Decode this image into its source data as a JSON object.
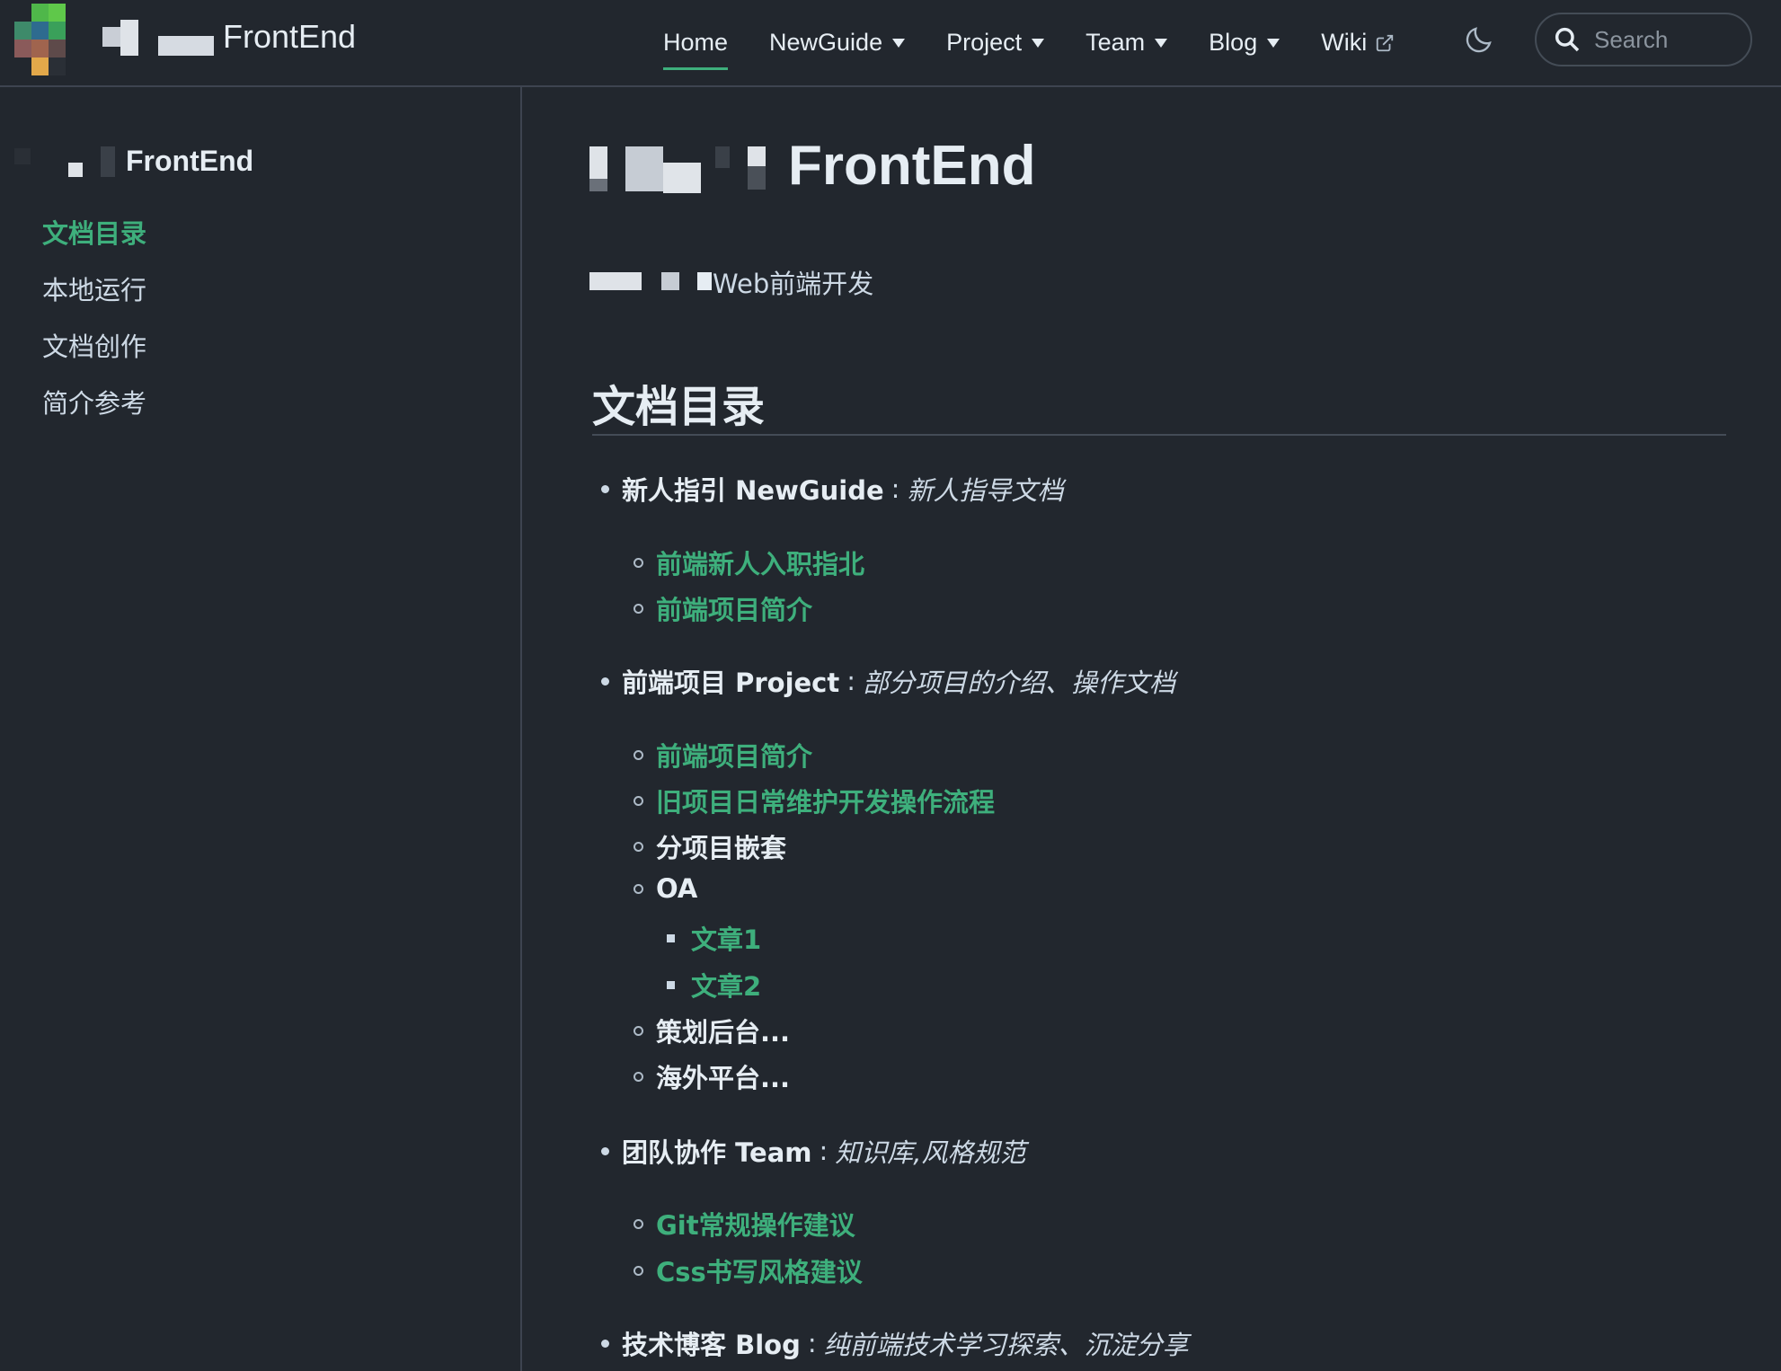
{
  "brand": {
    "name": "FrontEnd"
  },
  "nav": {
    "items": [
      {
        "label": "Home",
        "dropdown": false,
        "active": true
      },
      {
        "label": "NewGuide",
        "dropdown": true
      },
      {
        "label": "Project",
        "dropdown": true
      },
      {
        "label": "Team",
        "dropdown": true
      },
      {
        "label": "Blog",
        "dropdown": true
      },
      {
        "label": "Wiki",
        "dropdown": false,
        "external": true
      }
    ],
    "theme_toggle_icon": "moon-icon",
    "search_placeholder": "Search"
  },
  "sidebar": {
    "title": "FrontEnd",
    "items": [
      {
        "label": "文档目录",
        "active": true
      },
      {
        "label": "本地运行"
      },
      {
        "label": "文档创作"
      },
      {
        "label": "简介参考"
      }
    ]
  },
  "main": {
    "title": "FrontEnd",
    "tagline": "Web前端开发",
    "section_heading": "文档目录",
    "sections": [
      {
        "name": "新人指引 NewGuide",
        "desc": "新人指导文档",
        "children": [
          {
            "label": "前端新人入职指北",
            "link": true
          },
          {
            "label": "前端项目简介",
            "link": true
          }
        ]
      },
      {
        "name": "前端项目 Project",
        "desc": "部分项目的介绍、操作文档",
        "children": [
          {
            "label": "前端项目简介",
            "link": true
          },
          {
            "label": "旧项目日常维护开发操作流程",
            "link": true
          },
          {
            "label": "分项目嵌套",
            "link": false
          },
          {
            "label": "OA",
            "link": false,
            "children": [
              {
                "label": "文章1"
              },
              {
                "label": "文章2"
              }
            ]
          },
          {
            "label": "策划后台...",
            "link": false
          },
          {
            "label": "海外平台...",
            "link": false
          }
        ]
      },
      {
        "name": "团队协作 Team",
        "desc": "知识库,风格规范",
        "children": [
          {
            "label": "Git常规操作建议",
            "link": true
          },
          {
            "label": "Css书写风格建议",
            "link": true
          }
        ]
      },
      {
        "name": "技术博客 Blog",
        "desc": "纯前端技术学习探索、沉淀分享",
        "children": []
      }
    ]
  },
  "colors": {
    "background": "#22272e",
    "accent": "#3eaf7c",
    "border": "#3e4450"
  }
}
